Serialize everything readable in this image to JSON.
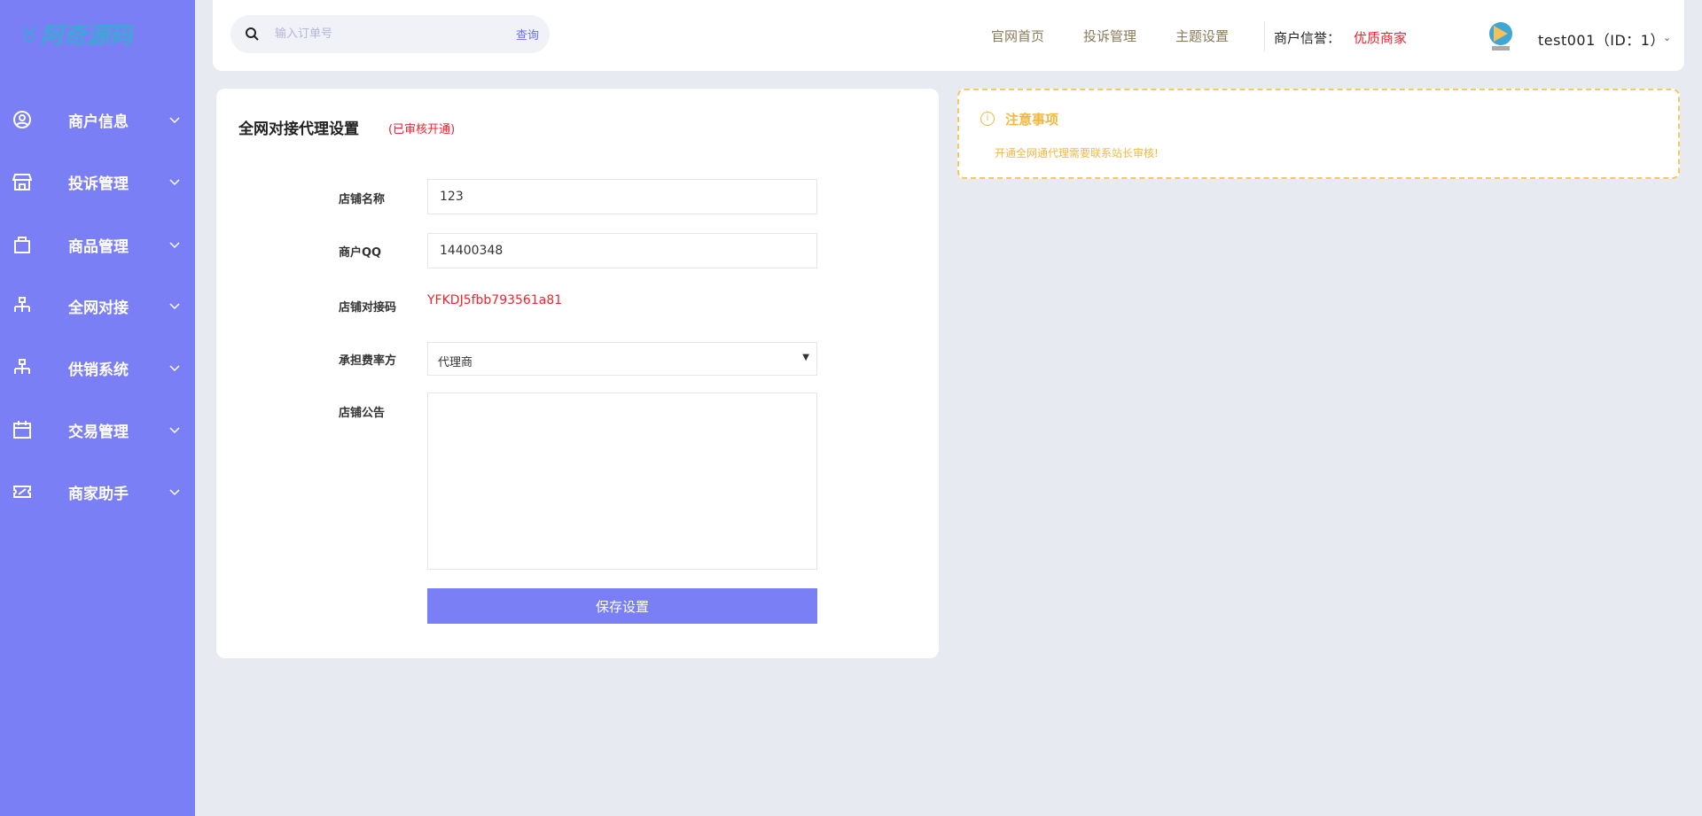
{
  "brand": {
    "logo_text": "阿奇源码"
  },
  "sidebar": {
    "items": [
      {
        "label": "商户信息",
        "icon": "user-circle-icon"
      },
      {
        "label": "投诉管理",
        "icon": "store-icon"
      },
      {
        "label": "商品管理",
        "icon": "bag-icon"
      },
      {
        "label": "全网对接",
        "icon": "sitemap-icon"
      },
      {
        "label": "供销系统",
        "icon": "sitemap-icon"
      },
      {
        "label": "交易管理",
        "icon": "calendar-icon"
      },
      {
        "label": "商家助手",
        "icon": "ticket-icon"
      }
    ]
  },
  "header": {
    "search_placeholder": "输入订单号",
    "search_button": "查询",
    "nav": [
      "官网首页",
      "投诉管理",
      "主题设置"
    ],
    "reputation_label": "商户信誉：",
    "reputation_value": "优质商家",
    "user": "test001（ID：1）"
  },
  "form": {
    "title": "全网对接代理设置",
    "status": "(已审核开通)",
    "shop_name_label": "店铺名称",
    "shop_name": "123",
    "qq_label": "商户QQ",
    "qq": "14400348",
    "code_label": "店铺对接码",
    "code": "YFKDJ5fbb793561a81",
    "fee_label": "承担费率方",
    "fee_value": "代理商",
    "notice_label": "店铺公告",
    "notice_value": "",
    "save": "保存设置"
  },
  "notice": {
    "title": "注意事项",
    "text": "开通全网通代理需要联系站长审核!"
  },
  "colors": {
    "accent": "#7b7ff6",
    "danger": "#f5222d",
    "warning": "#f0b840"
  }
}
